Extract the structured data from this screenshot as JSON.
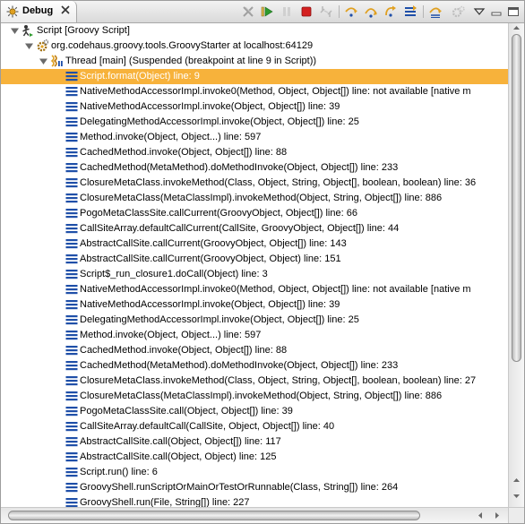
{
  "view": {
    "tab_label": "Debug",
    "icons": {
      "view": "debug-bug-icon",
      "close": "close-icon",
      "toolbar": [
        "remove-all-terminated-icon",
        "resume-icon",
        "suspend-icon",
        "terminate-icon",
        "disconnect-icon",
        "step-into-icon",
        "step-over-icon",
        "step-return-icon",
        "drop-to-frame-icon",
        "use-step-filters-icon",
        "debug-gear-icon",
        "view-menu-icon",
        "minimize-icon",
        "maximize-icon"
      ]
    }
  },
  "colors": {
    "selection": "#f7b23b",
    "frame_icon": "#1f4fa8",
    "resume": "#2e9b2e",
    "terminate": "#d42020"
  },
  "tree": {
    "launch": "Script [Groovy Script]",
    "target": "org.codehaus.groovy.tools.GroovyStarter at localhost:64129",
    "thread": "Thread [main] (Suspended (breakpoint at line 9 in Script))",
    "frames": [
      "Script.format(Object) line: 9",
      "NativeMethodAccessorImpl.invoke0(Method, Object, Object[]) line: not available [native m",
      "NativeMethodAccessorImpl.invoke(Object, Object[]) line: 39",
      "DelegatingMethodAccessorImpl.invoke(Object, Object[]) line: 25",
      "Method.invoke(Object, Object...) line: 597",
      "CachedMethod.invoke(Object, Object[]) line: 88",
      "CachedMethod(MetaMethod).doMethodInvoke(Object, Object[]) line: 233",
      "ClosureMetaClass.invokeMethod(Class, Object, String, Object[], boolean, boolean) line: 36",
      "ClosureMetaClass(MetaClassImpl).invokeMethod(Object, String, Object[]) line: 886",
      "PogoMetaClassSite.callCurrent(GroovyObject, Object[]) line: 66",
      "CallSiteArray.defaultCallCurrent(CallSite, GroovyObject, Object[]) line: 44",
      "AbstractCallSite.callCurrent(GroovyObject, Object[]) line: 143",
      "AbstractCallSite.callCurrent(GroovyObject, Object) line: 151",
      "Script$_run_closure1.doCall(Object) line: 3",
      "NativeMethodAccessorImpl.invoke0(Method, Object, Object[]) line: not available [native m",
      "NativeMethodAccessorImpl.invoke(Object, Object[]) line: 39",
      "DelegatingMethodAccessorImpl.invoke(Object, Object[]) line: 25",
      "Method.invoke(Object, Object...) line: 597",
      "CachedMethod.invoke(Object, Object[]) line: 88",
      "CachedMethod(MetaMethod).doMethodInvoke(Object, Object[]) line: 233",
      "ClosureMetaClass.invokeMethod(Class, Object, String, Object[], boolean, boolean) line: 27",
      "ClosureMetaClass(MetaClassImpl).invokeMethod(Object, String, Object[]) line: 886",
      "PogoMetaClassSite.call(Object, Object[]) line: 39",
      "CallSiteArray.defaultCall(CallSite, Object, Object[]) line: 40",
      "AbstractCallSite.call(Object, Object[]) line: 117",
      "AbstractCallSite.call(Object, Object) line: 125",
      "Script.run() line: 6",
      "GroovyShell.runScriptOrMainOrTestOrRunnable(Class, String[]) line: 264",
      "GroovyShell.run(File, String[]) line: 227"
    ]
  }
}
